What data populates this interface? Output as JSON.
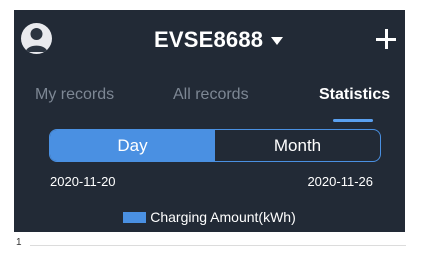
{
  "header": {
    "station_name": "EVSE8688",
    "avatar_icon": "user-avatar-icon",
    "dropdown_icon": "caret-down-icon",
    "add_icon": "plus-icon"
  },
  "tabs": [
    {
      "label": "My records",
      "active": false
    },
    {
      "label": "All records",
      "active": false
    },
    {
      "label": "Statistics",
      "active": true
    }
  ],
  "period_toggle": {
    "options": [
      "Day",
      "Month"
    ],
    "selected": "Day"
  },
  "date_range": {
    "start": "2020-11-20",
    "end": "2020-11-26"
  },
  "chart": {
    "legend_label": "Charging Amount(kWh)",
    "y_tick_top": "1"
  },
  "colors": {
    "panel_background": "#222a36",
    "accent": "#4a90e2",
    "inactive_tab": "#7d8794"
  }
}
